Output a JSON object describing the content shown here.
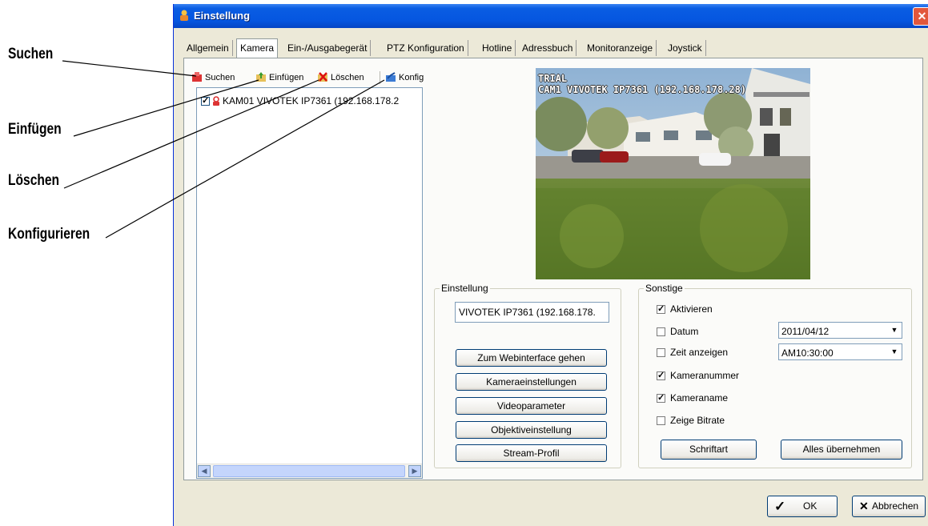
{
  "callouts": [
    "Suchen",
    "Einfügen",
    "Löschen",
    "Konfigurieren"
  ],
  "window": {
    "title": "Einstellung",
    "close": "✕"
  },
  "tabs": [
    "Allgemein",
    "Kamera",
    "Ein-/Ausgabegerät",
    "PTZ Konfiguration",
    "Hotline",
    "Adressbuch",
    "Monitoranzeige",
    "Joystick"
  ],
  "toolbar": {
    "search": "Suchen",
    "insert": "Einfügen",
    "delete": "Löschen",
    "config": "Konfig"
  },
  "camera_list": [
    {
      "label": "KAM01 VIVOTEK IP7361 (192.168.178.2",
      "checked": true
    }
  ],
  "preview": {
    "osd_line1": "TRIAL",
    "osd_line2": "CAM1 VIVOTEK IP7361 (192.168.178.28)"
  },
  "settings": {
    "legend": "Einstellung",
    "camera_name": "VIVOTEK IP7361 (192.168.178.",
    "buttons": [
      "Zum Webinterface gehen",
      "Kameraeinstellungen",
      "Videoparameter",
      "Objektiveinstellung",
      "Stream-Profil"
    ]
  },
  "other": {
    "legend": "Sonstige",
    "checkboxes": [
      {
        "label": "Aktivieren",
        "checked": true
      },
      {
        "label": "Datum",
        "checked": false
      },
      {
        "label": "Zeit anzeigen",
        "checked": false
      },
      {
        "label": "Kameranummer",
        "checked": true
      },
      {
        "label": "Kameraname",
        "checked": true
      },
      {
        "label": "Zeige Bitrate",
        "checked": false
      }
    ],
    "date_value": "2011/04/12",
    "time_value": "AM10:30:00",
    "font_button": "Schriftart",
    "apply_all_button": "Alles übernehmen"
  },
  "footer": {
    "ok": "OK",
    "cancel": "Abbrechen"
  },
  "icons": {
    "ok": "check-icon",
    "cancel": "x-icon"
  },
  "colors": {
    "titlebar": "#0556e0",
    "dialog_bg": "#ece9d8"
  }
}
